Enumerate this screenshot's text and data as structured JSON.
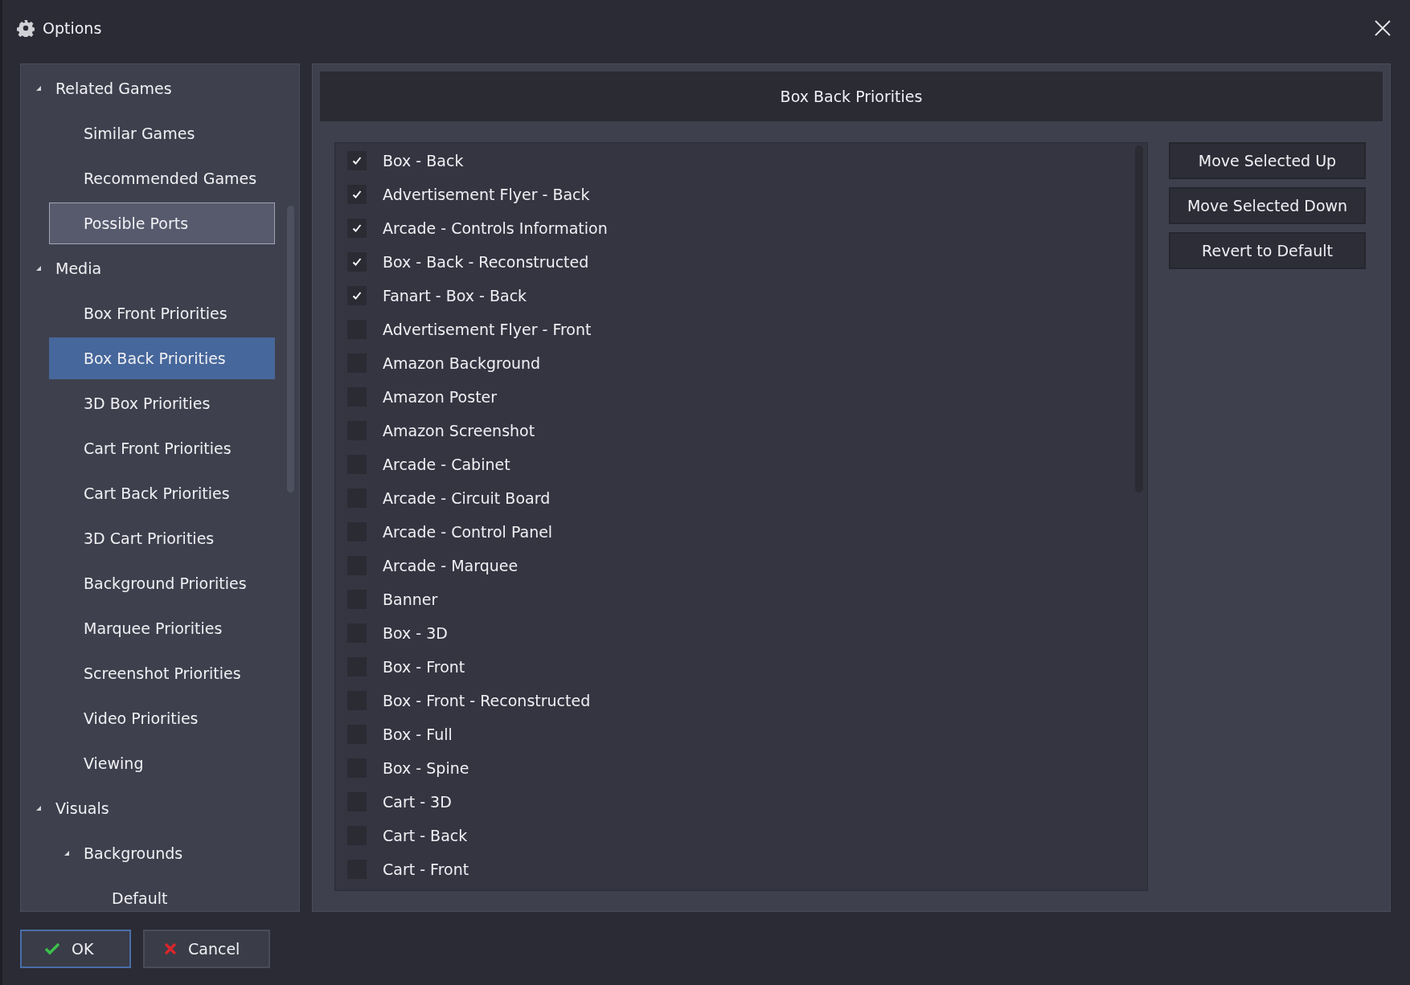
{
  "window": {
    "title": "Options"
  },
  "sidebar": {
    "items": [
      {
        "label": "Related Games",
        "expanded": true,
        "selected": false,
        "hovered": false,
        "children": [
          {
            "label": "Similar Games",
            "selected": false,
            "hovered": false
          },
          {
            "label": "Recommended Games",
            "selected": false,
            "hovered": false
          },
          {
            "label": "Possible Ports",
            "selected": false,
            "hovered": true
          }
        ]
      },
      {
        "label": "Media",
        "expanded": true,
        "selected": false,
        "hovered": false,
        "children": [
          {
            "label": "Box Front Priorities",
            "selected": false,
            "hovered": false
          },
          {
            "label": "Box Back Priorities",
            "selected": true,
            "hovered": false
          },
          {
            "label": "3D Box Priorities",
            "selected": false,
            "hovered": false
          },
          {
            "label": "Cart Front Priorities",
            "selected": false,
            "hovered": false
          },
          {
            "label": "Cart Back Priorities",
            "selected": false,
            "hovered": false
          },
          {
            "label": "3D Cart Priorities",
            "selected": false,
            "hovered": false
          },
          {
            "label": "Background Priorities",
            "selected": false,
            "hovered": false
          },
          {
            "label": "Marquee Priorities",
            "selected": false,
            "hovered": false
          },
          {
            "label": "Screenshot Priorities",
            "selected": false,
            "hovered": false
          },
          {
            "label": "Video Priorities",
            "selected": false,
            "hovered": false
          },
          {
            "label": "Viewing",
            "selected": false,
            "hovered": false
          }
        ]
      },
      {
        "label": "Visuals",
        "expanded": true,
        "selected": false,
        "hovered": false,
        "children": [
          {
            "label": "Backgrounds",
            "expanded": true,
            "selected": false,
            "hovered": false,
            "children": [
              {
                "label": "Default",
                "selected": false,
                "hovered": false
              }
            ]
          }
        ]
      }
    ]
  },
  "panel": {
    "title": "Box Back Priorities",
    "items": [
      {
        "label": "Box - Back",
        "checked": true
      },
      {
        "label": "Advertisement Flyer - Back",
        "checked": true
      },
      {
        "label": "Arcade - Controls Information",
        "checked": true
      },
      {
        "label": "Box - Back - Reconstructed",
        "checked": true
      },
      {
        "label": "Fanart - Box - Back",
        "checked": true
      },
      {
        "label": "Advertisement Flyer - Front",
        "checked": false
      },
      {
        "label": "Amazon Background",
        "checked": false
      },
      {
        "label": "Amazon Poster",
        "checked": false
      },
      {
        "label": "Amazon Screenshot",
        "checked": false
      },
      {
        "label": "Arcade - Cabinet",
        "checked": false
      },
      {
        "label": "Arcade - Circuit Board",
        "checked": false
      },
      {
        "label": "Arcade - Control Panel",
        "checked": false
      },
      {
        "label": "Arcade - Marquee",
        "checked": false
      },
      {
        "label": "Banner",
        "checked": false
      },
      {
        "label": "Box - 3D",
        "checked": false
      },
      {
        "label": "Box - Front",
        "checked": false
      },
      {
        "label": "Box - Front - Reconstructed",
        "checked": false
      },
      {
        "label": "Box - Full",
        "checked": false
      },
      {
        "label": "Box - Spine",
        "checked": false
      },
      {
        "label": "Cart - 3D",
        "checked": false
      },
      {
        "label": "Cart - Back",
        "checked": false
      },
      {
        "label": "Cart - Front",
        "checked": false
      }
    ],
    "buttons": [
      "Move Selected Up",
      "Move Selected Down",
      "Revert to Default"
    ]
  },
  "footer": {
    "buttons": [
      {
        "label": "OK",
        "kind": "ok",
        "focused": true
      },
      {
        "label": "Cancel",
        "kind": "cancel",
        "focused": false
      }
    ]
  }
}
